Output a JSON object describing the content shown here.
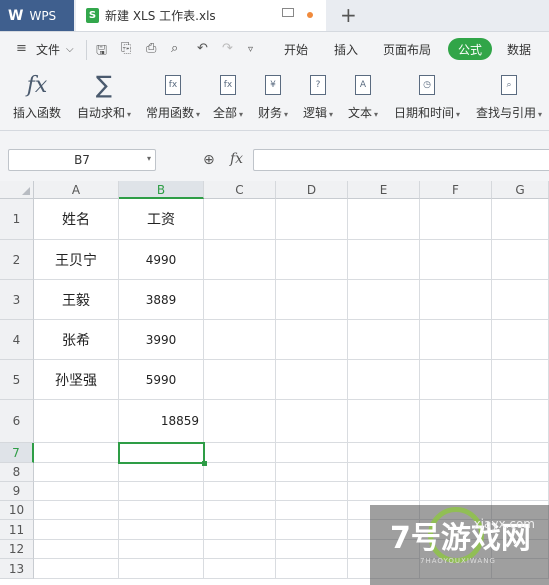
{
  "titlebar": {
    "app": "WPS",
    "file_tab": "新建 XLS 工作表.xls"
  },
  "menubar": {
    "file": "文件",
    "tabs": [
      "开始",
      "插入",
      "页面布局",
      "公式",
      "数据"
    ],
    "active_tab": "公式"
  },
  "ribbon": {
    "buttons": [
      {
        "label": "插入函数",
        "icon": "fx-icon"
      },
      {
        "label": "自动求和",
        "icon": "sigma-icon"
      },
      {
        "label": "常用函数",
        "icon": "function-star-icon"
      },
      {
        "label": "全部",
        "icon": "fx-box-icon"
      },
      {
        "label": "财务",
        "icon": "yen-icon"
      },
      {
        "label": "逻辑",
        "icon": "question-icon"
      },
      {
        "label": "文本",
        "icon": "text-a-icon"
      },
      {
        "label": "日期和时间",
        "icon": "clock-icon"
      },
      {
        "label": "查找与引用",
        "icon": "search-book-icon"
      }
    ]
  },
  "formulabar": {
    "cell_ref": "B7",
    "fx": "fx",
    "formula": ""
  },
  "sheet": {
    "columns": [
      "A",
      "B",
      "C",
      "D",
      "E",
      "F",
      "G"
    ],
    "rows": [
      "1",
      "2",
      "3",
      "4",
      "5",
      "6",
      "7",
      "8",
      "9",
      "10",
      "11",
      "12",
      "13"
    ],
    "cells": {
      "A1": "姓名",
      "B1": "工资",
      "A2": "王贝宁",
      "B2": "4990",
      "A3": "王毅",
      "B3": "3889",
      "A4": "张希",
      "B4": "3990",
      "A5": "孙坚强",
      "B5": "5990",
      "B6": "18859"
    },
    "selected_cell": "B7"
  },
  "watermark": {
    "brand": "7号游戏网",
    "site": "xiayx.com",
    "sub": "7HAOYOUXIWANG"
  },
  "colors": {
    "accent": "#31a548",
    "wps_tab": "#3f5f8e"
  }
}
